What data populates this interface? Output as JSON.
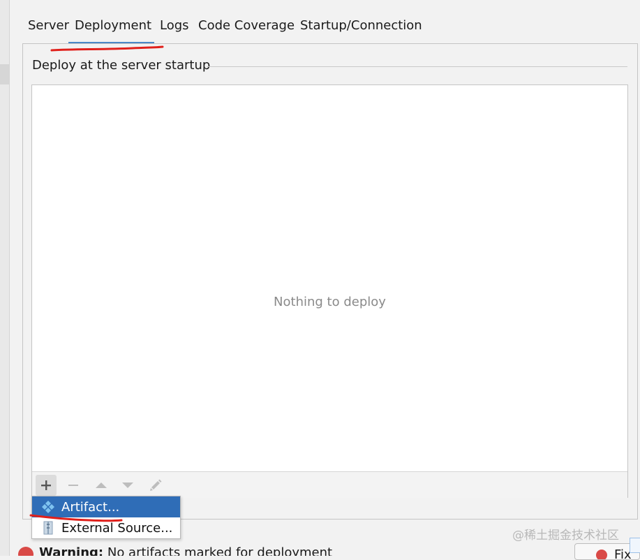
{
  "tabs": [
    {
      "label": "Server"
    },
    {
      "label": "Deployment"
    },
    {
      "label": "Logs"
    },
    {
      "label": "Code Coverage"
    },
    {
      "label": "Startup/Connection"
    }
  ],
  "active_tab": "Deployment",
  "section": {
    "title": "Deploy at the server startup",
    "empty_text": "Nothing to deploy"
  },
  "toolbar": {
    "buttons": [
      "plus-icon",
      "minus-icon",
      "arrow-up-icon",
      "arrow-down-icon",
      "pencil-icon"
    ]
  },
  "popup_menu": {
    "items": [
      {
        "label": "Artifact...",
        "icon": "artifact-icon",
        "selected": true
      },
      {
        "label": "External Source...",
        "icon": "archive-icon",
        "selected": false
      }
    ]
  },
  "warning": {
    "prefix": "Warning:",
    "message": "No artifacts marked for deployment"
  },
  "fix_button": {
    "label": "Fix"
  },
  "watermark": "@稀土掘金技术社区",
  "colors": {
    "selection": "#2f6db7",
    "tab_underline": "#4a88c7",
    "annotation": "#e0201b",
    "error": "#d94a47"
  }
}
